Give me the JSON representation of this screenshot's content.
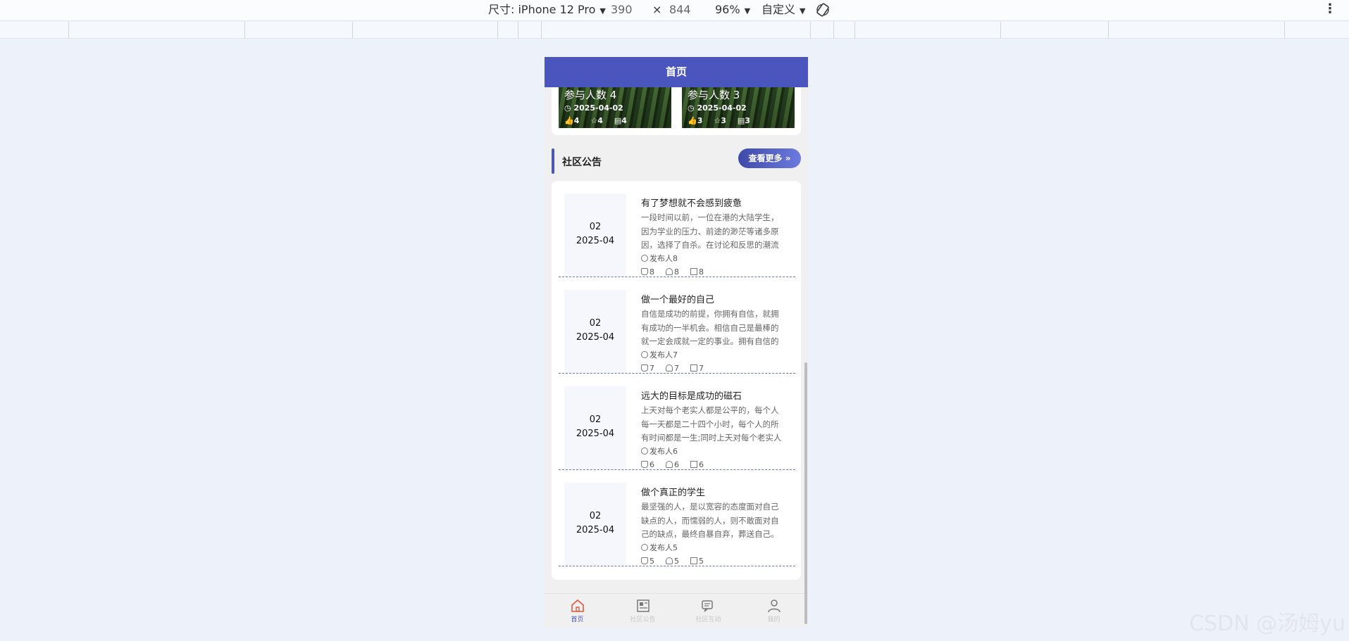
{
  "devtools": {
    "size_label": "尺寸: iPhone 12 Pro",
    "width": "390",
    "times": "×",
    "height": "844",
    "zoom": "96%",
    "mode": "自定义",
    "more": "⋮"
  },
  "nav": {
    "title": "首页"
  },
  "activities": [
    {
      "people": "参与人数 4",
      "date": "2025-04-02",
      "likes": "4",
      "stars": "4",
      "comments": "4"
    },
    {
      "people": "参与人数 3",
      "date": "2025-04-02",
      "likes": "3",
      "stars": "3",
      "comments": "3"
    }
  ],
  "section": {
    "title": "社区公告",
    "more_label": "查看更多 »"
  },
  "notices": [
    {
      "day": "02",
      "month": "2025-04",
      "title": "有了梦想就不会感到疲惫",
      "desc": "一段时间以前，一位在港的大陆学生，因为学业的压力、前途的渺茫等诸多原因，选择了自杀。在讨论和反思的潮流",
      "author": "发布人8",
      "likes": "8",
      "stars": "8",
      "comments": "8"
    },
    {
      "day": "02",
      "month": "2025-04",
      "title": "做一个最好的自己",
      "desc": "自信是成功的前提，你拥有自信，就拥有成功的一半机会。相信自己是最棒的就一定会成就一定的事业。拥有自信的",
      "author": "发布人7",
      "likes": "7",
      "stars": "7",
      "comments": "7"
    },
    {
      "day": "02",
      "month": "2025-04",
      "title": "远大的目标是成功的磁石",
      "desc": "上天对每个老实人都是公平的，每个人每一天都是二十四个小时，每个人的所有时间都是一生;同时上天对每个老实人",
      "author": "发布人6",
      "likes": "6",
      "stars": "6",
      "comments": "6"
    },
    {
      "day": "02",
      "month": "2025-04",
      "title": "做个真正的学生",
      "desc": "最坚强的人，是以宽容的态度面对自己缺点的人，而懦弱的人，则不敢面对自己的缺点，最终自暴自弃，葬送自己。",
      "author": "发布人5",
      "likes": "5",
      "stars": "5",
      "comments": "5"
    }
  ],
  "tabs": [
    {
      "label": "首页",
      "icon": "home-icon",
      "active": true
    },
    {
      "label": "社区公告",
      "icon": "news-icon",
      "active": false
    },
    {
      "label": "社区互动",
      "icon": "chat-icon",
      "active": false
    },
    {
      "label": "我的",
      "icon": "user-icon",
      "active": false
    }
  ],
  "colors": {
    "primary": "#4a56bd",
    "active_tab_icon": "#e05a3a"
  },
  "watermark": "CSDN @汤姆yu"
}
